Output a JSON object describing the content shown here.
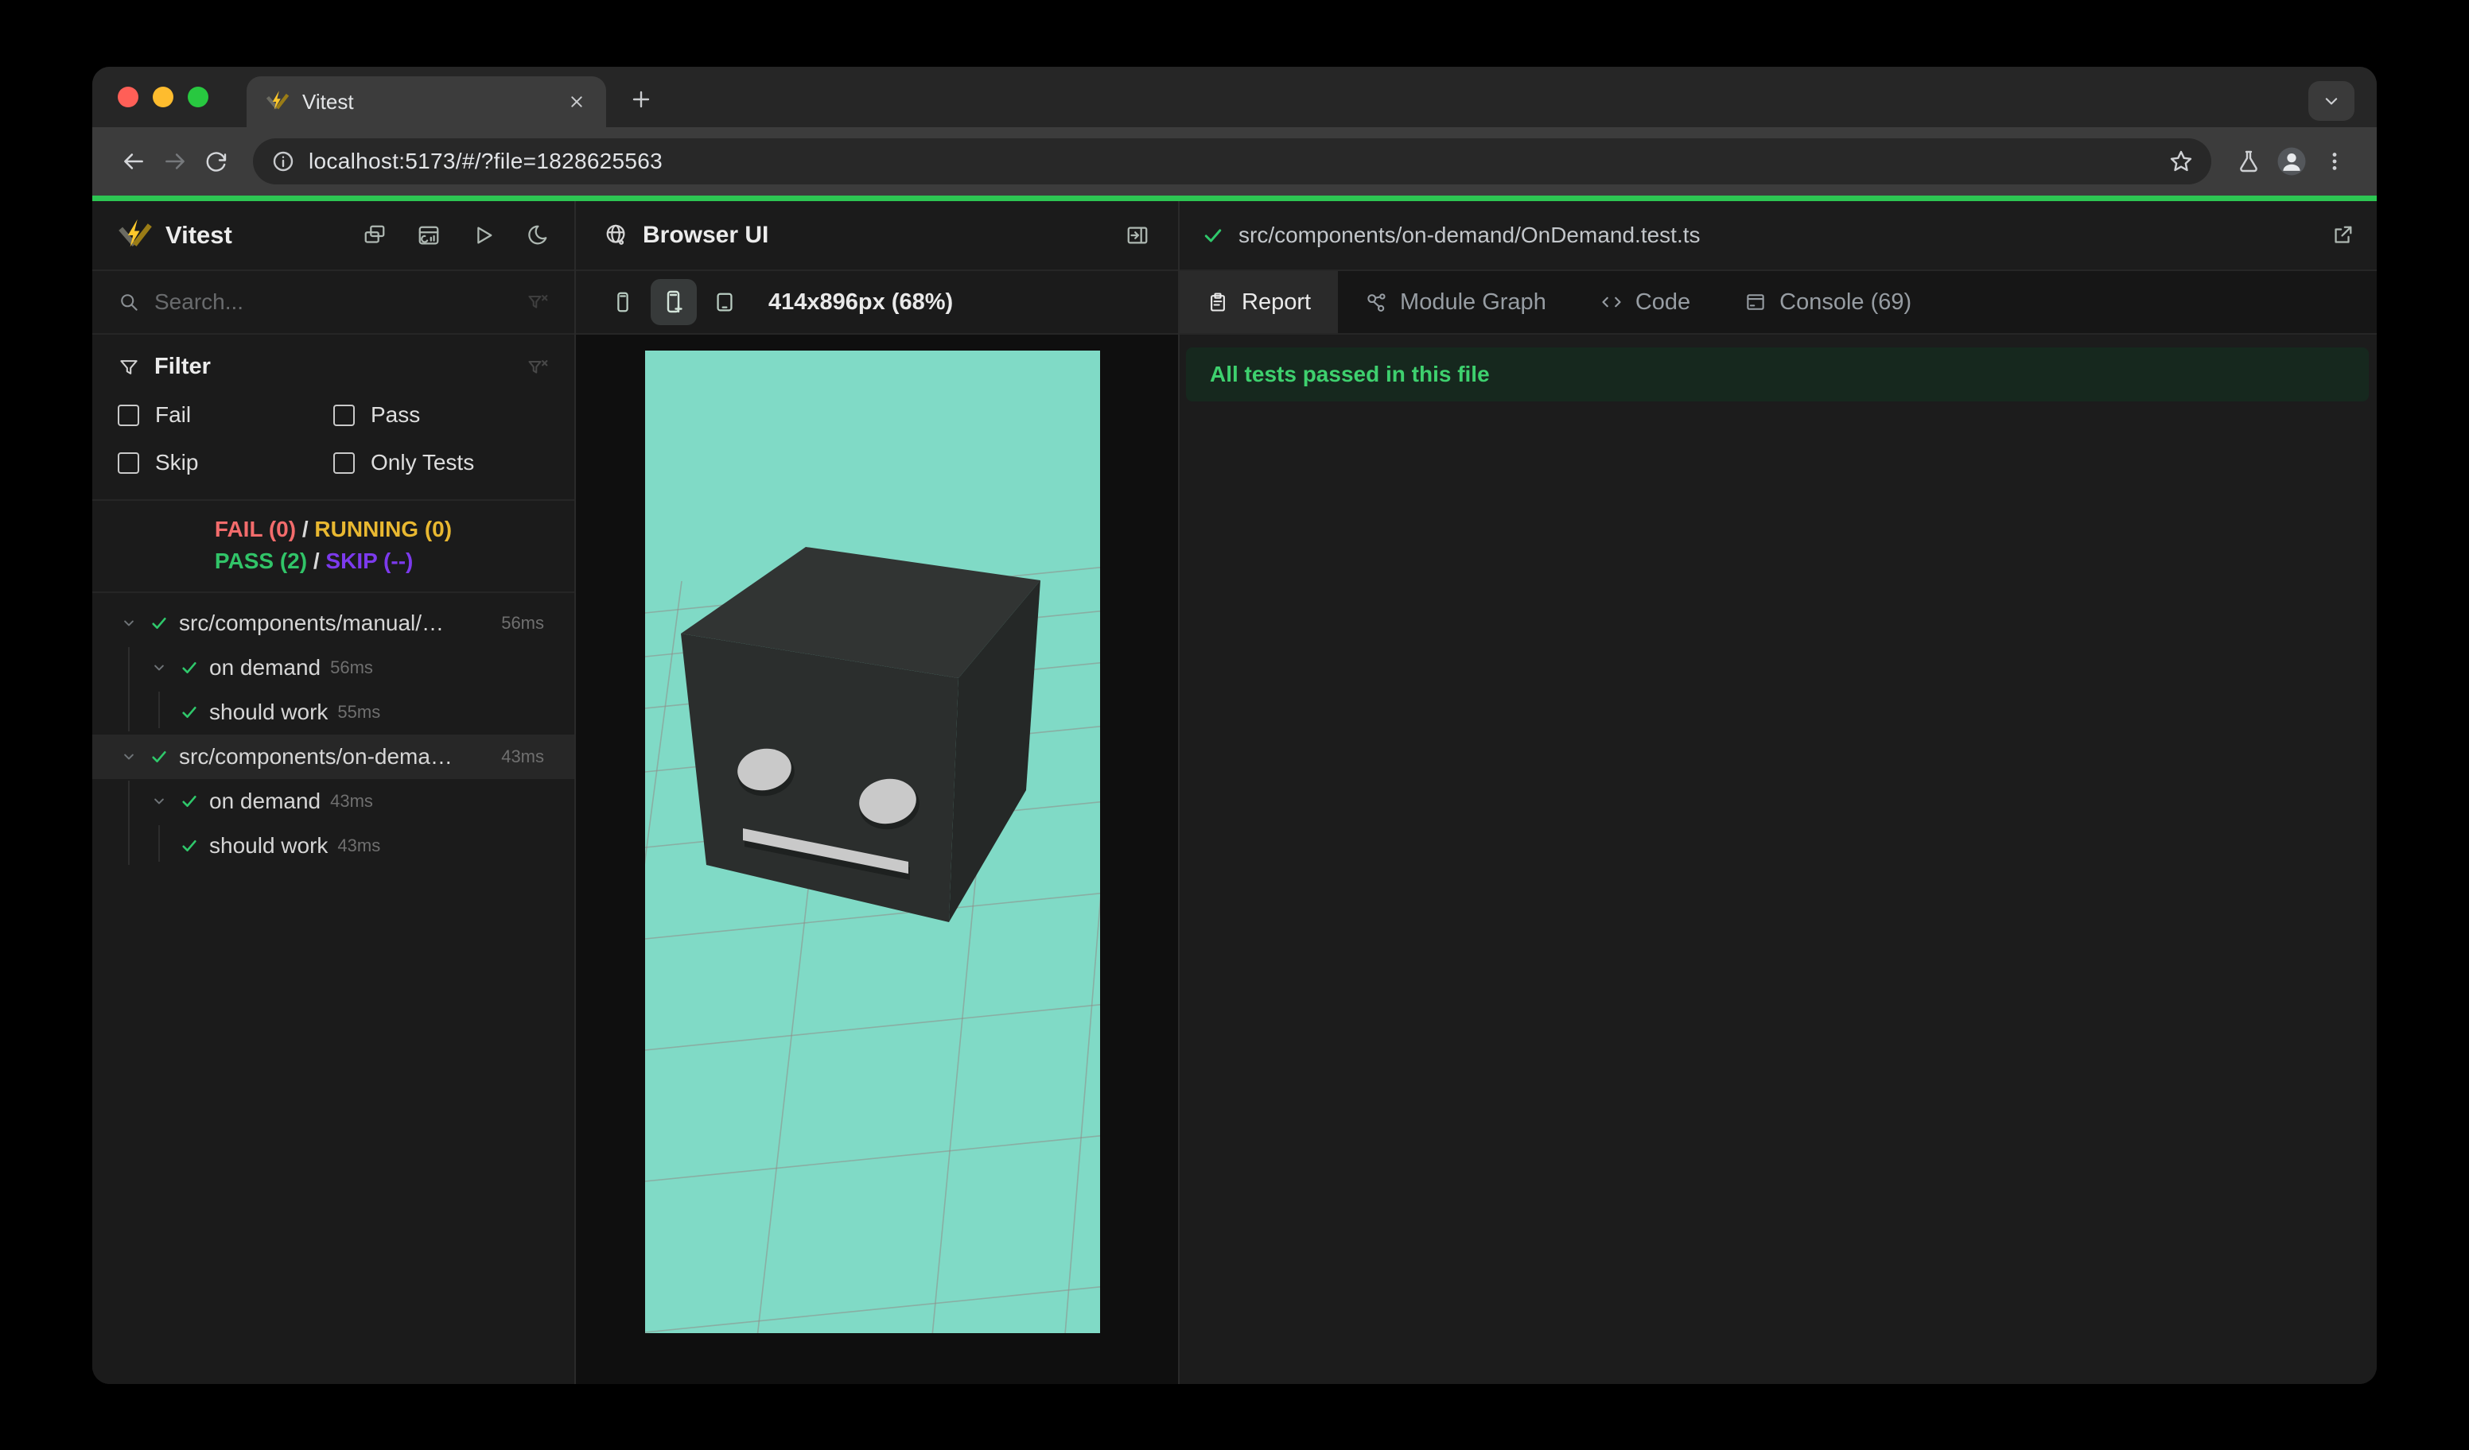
{
  "chrome": {
    "tab_title": "Vitest",
    "url": "localhost:5173/#/?file=1828625563"
  },
  "sidebar": {
    "title": "Vitest",
    "search_placeholder": "Search...",
    "filter": {
      "title": "Filter",
      "options": [
        "Fail",
        "Pass",
        "Skip",
        "Only Tests"
      ]
    },
    "stats": {
      "fail": "FAIL (0)",
      "running": "RUNNING (0)",
      "pass": "PASS (2)",
      "skip": "SKIP (--)",
      "sep1": "/",
      "sep2": "/"
    },
    "tree": [
      {
        "type": "file",
        "label": "src/components/manual/…",
        "duration": "56ms"
      },
      {
        "type": "suite",
        "label": "on demand",
        "duration": "56ms"
      },
      {
        "type": "test",
        "label": "should work",
        "duration": "55ms"
      },
      {
        "type": "file",
        "label": "src/components/on-dema…",
        "duration": "43ms",
        "selected": true
      },
      {
        "type": "suite",
        "label": "on demand",
        "duration": "43ms"
      },
      {
        "type": "test",
        "label": "should work",
        "duration": "43ms"
      }
    ]
  },
  "browser_panel": {
    "title": "Browser UI",
    "viewport": "414x896px (68%)"
  },
  "report_panel": {
    "file": "src/components/on-demand/OnDemand.test.ts",
    "tabs": [
      "Report",
      "Module Graph",
      "Code",
      "Console (69)"
    ],
    "banner": "All tests passed in this file"
  },
  "colors": {
    "accent_green": "#2dc653",
    "mint_background": "#80dac6",
    "fail": "#f36c6c",
    "running": "#e9b831",
    "pass": "#31c468",
    "skip": "#7c3aed",
    "banner_text": "#3ed06e",
    "traffic_red": "#ff5f57",
    "traffic_yellow": "#febc2e",
    "traffic_green": "#28c840"
  }
}
